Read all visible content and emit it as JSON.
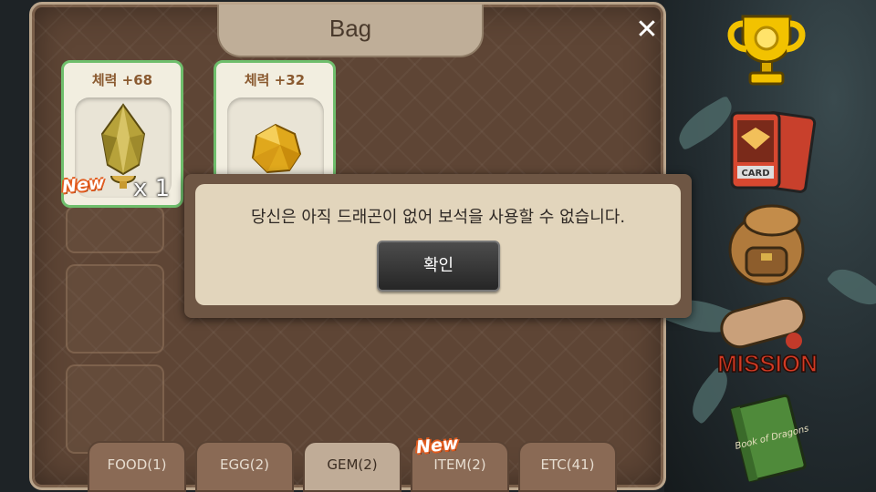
{
  "bag": {
    "title": "Bag",
    "close_label": "✕",
    "items": [
      {
        "stat": "체력 +68",
        "count": "x 1",
        "new_badge": "New",
        "icon": "crystal-trophy-icon"
      },
      {
        "stat": "체력 +32",
        "icon": "gold-gem-icon"
      }
    ],
    "tabs": [
      {
        "label": "FOOD(1)"
      },
      {
        "label": "EGG(2)"
      },
      {
        "label": "GEM(2)",
        "active": true
      },
      {
        "label": "ITEM(2)",
        "new_badge": "New"
      },
      {
        "label": "ETC(41)"
      }
    ]
  },
  "dialog": {
    "message": "당신은 아직 드래곤이 없어 보석을 사용할 수 없습니다.",
    "confirm_label": "확인"
  },
  "side_menu": {
    "card_label": "CARD",
    "mission_label": "MISSION",
    "book_label": "Book of Dragons",
    "icons": [
      "trophy-icon",
      "card-icon",
      "backpack-icon",
      "mission-icon",
      "book-icon"
    ]
  },
  "colors": {
    "panel": "#5e4535",
    "card_border": "#6fbe6c",
    "new_badge": "#e25c1f",
    "trophy": "#f2c200"
  }
}
